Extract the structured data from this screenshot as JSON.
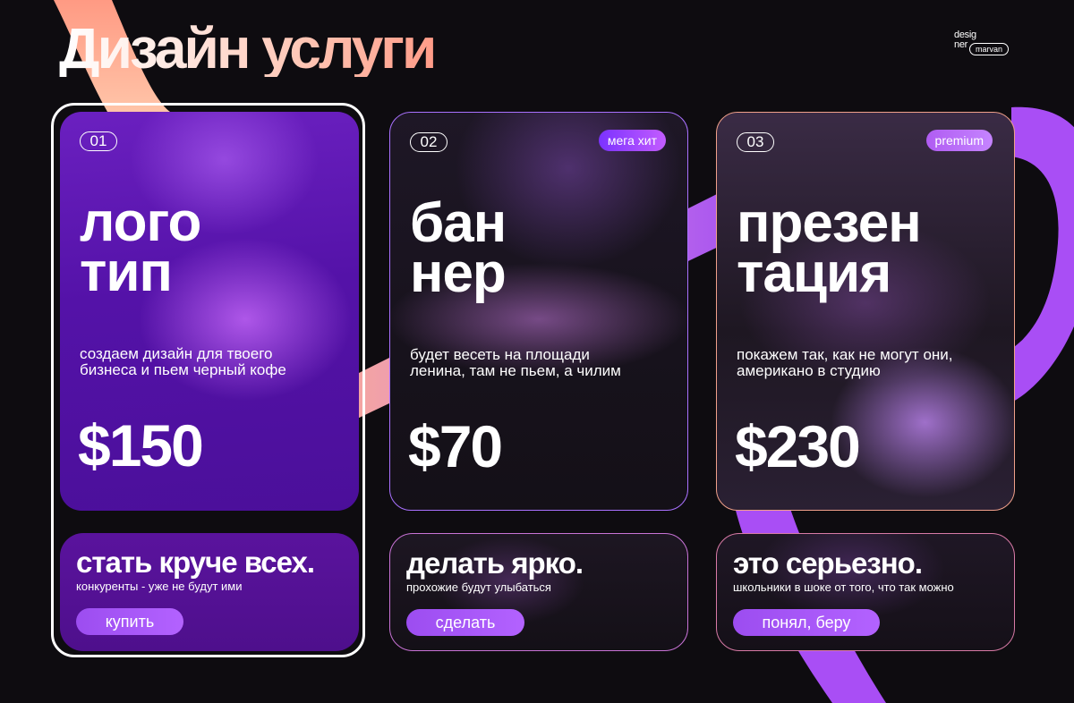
{
  "page": {
    "title": "Дизайн услуги",
    "logo": {
      "line1": "desig",
      "line2": "ner",
      "pill": "marvan"
    }
  },
  "colors": {
    "background": "#0e0c10",
    "accent_purple": "#a94ef5",
    "accent_peach": "#ffb29e",
    "card1_purple": "#5412a8",
    "button_purple": "#a858f5"
  },
  "services": [
    {
      "number": "01",
      "tag": "",
      "name_line1": "лого",
      "name_line2": "тип",
      "description": "создаем дизайн для твоего бизнеса и пьем черный кофе",
      "price": "$150",
      "slogan": "стать круче всех.",
      "subtext": "конкуренты - уже не будут ими",
      "button": "купить",
      "selected": true
    },
    {
      "number": "02",
      "tag": "мега хит",
      "name_line1": "бан",
      "name_line2": "нер",
      "description": "будет весеть на площади ленина, там не пьем, а чилим",
      "price": "$70",
      "slogan": "делать ярко.",
      "subtext": "прохожие будут улыбаться",
      "button": "сделать",
      "selected": false
    },
    {
      "number": "03",
      "tag": "premium",
      "name_line1": "презен",
      "name_line2": "тация",
      "description": "покажем так, как не могут они, американо в студию",
      "price": "$230",
      "slogan": "это серьезно.",
      "subtext": "школьники в шоке от того, что так можно",
      "button": "понял, беру",
      "selected": false
    }
  ],
  "icons": [
    "designer-logo-icon"
  ]
}
